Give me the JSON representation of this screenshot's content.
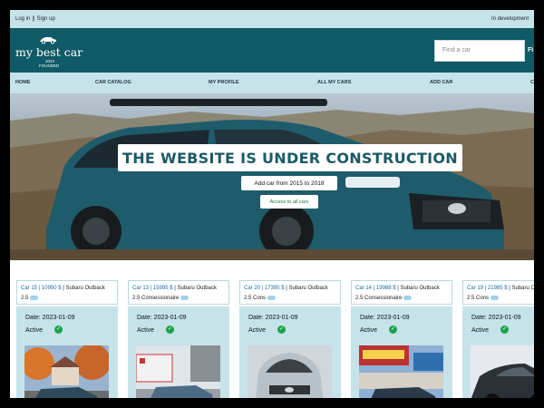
{
  "topbar": {
    "login": "Log in",
    "separator": "||",
    "signup": "Sign up",
    "status": "In development"
  },
  "logo": {
    "brand": "my best car",
    "year": "2023",
    "founded": "FOUNDED"
  },
  "search": {
    "placeholder": "Find a car",
    "button": "Fi"
  },
  "nav": {
    "items": [
      "HOME",
      "CAR CATALOG",
      "MY PROFILE",
      "ALL MY CARS",
      "ADD CAR",
      "C"
    ]
  },
  "hero": {
    "title": "THE WEBSITE IS UNDER CONSTRUCTION",
    "subtitle": "Add car from 2015 to 2018",
    "button": "Access to all cars"
  },
  "cards": [
    {
      "link": "Car 15 | 10950 $",
      "rest": " | Subaru Outback 2.5",
      "date": "Date: 2023-01-09",
      "status": "Active",
      "photo": "autumn-street"
    },
    {
      "link": "Car 13 | 15995 $",
      "rest": " | Subaru Outback 2.5 Consessionaire",
      "date": "Date: 2023-01-09",
      "status": "Active",
      "photo": "dealership-lot"
    },
    {
      "link": "Car 20 | 17395 $",
      "rest": " | Subaru Outback 2.5 Cons",
      "date": "Date: 2023-01-09",
      "status": "Active",
      "photo": "silver-front"
    },
    {
      "link": "Car 14 | 19988 $",
      "rest": " | Subaru Outback 2.5 Consessionaire",
      "date": "Date: 2023-01-09",
      "status": "Active",
      "photo": "fine-cars-lot"
    },
    {
      "link": "Car 19 | 21985 $",
      "rest": " | Subaru Outback 2.5 Cons",
      "date": "Date: 2023-01-09",
      "status": "Active",
      "photo": "dark-side"
    }
  ]
}
